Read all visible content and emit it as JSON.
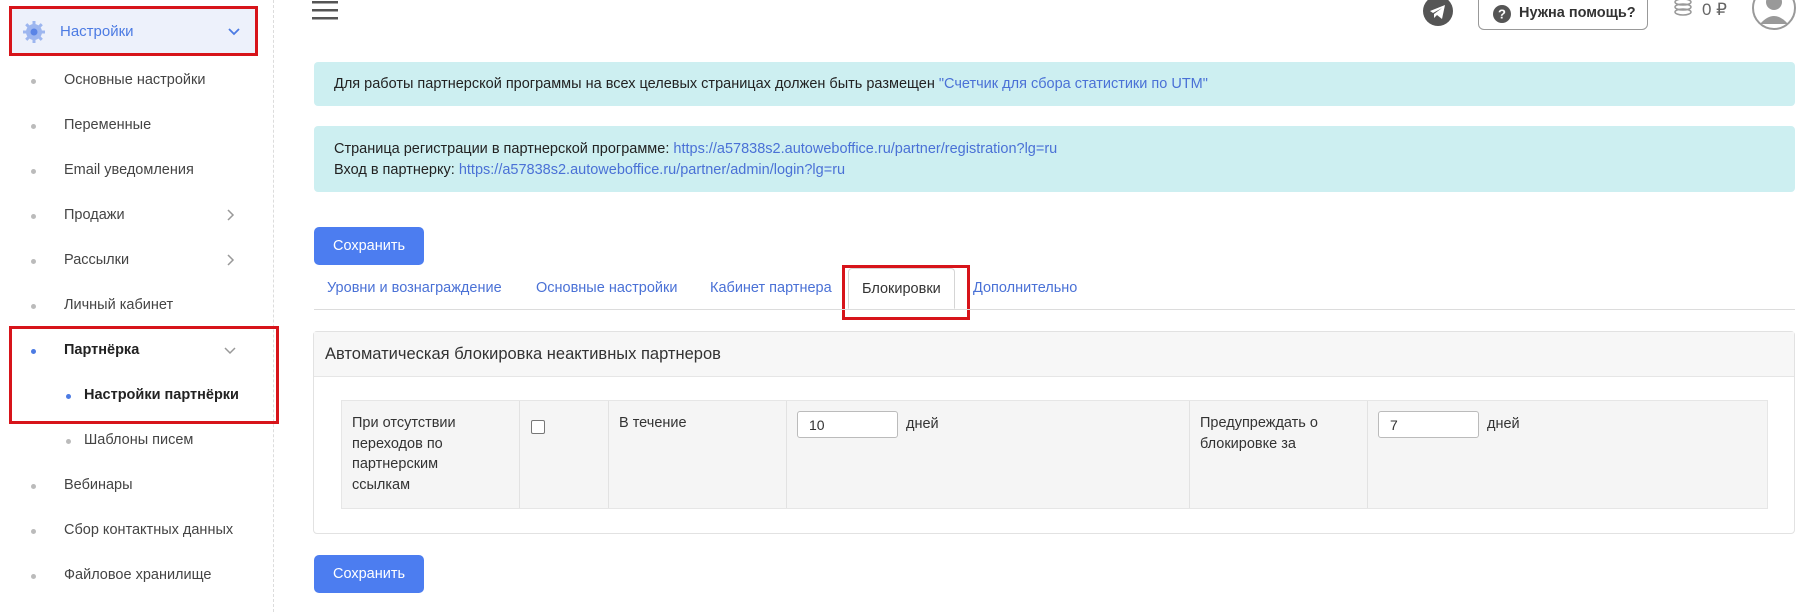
{
  "sidebar": {
    "settings_label": "Настройки",
    "items": [
      {
        "label": "Основные настройки"
      },
      {
        "label": "Переменные"
      },
      {
        "label": "Email уведомления"
      },
      {
        "label": "Продажи"
      },
      {
        "label": "Рассылки"
      },
      {
        "label": "Личный кабинет"
      },
      {
        "label": "Партнёрка"
      },
      {
        "label": "Настройки партнёрки"
      },
      {
        "label": "Шаблоны писем"
      },
      {
        "label": "Вебинары"
      },
      {
        "label": "Сбор контактных данных"
      },
      {
        "label": "Файловое хранилище"
      }
    ]
  },
  "header": {
    "help_label": "Нужна помощь?",
    "balance": "0 ₽"
  },
  "alerts": {
    "utm_text": "Для работы партнерской программы на всех целевых страницах должен быть размещен ",
    "utm_link": "\"Счетчик для сбора статистики по UTM\"",
    "reg_text": "Страница регистрации в партнерской программе: ",
    "reg_link": "https://a57838s2.autoweboffice.ru/partner/registration?lg=ru",
    "login_text": "Вход в партнерку: ",
    "login_link": "https://a57838s2.autoweboffice.ru/partner/admin/login?lg=ru"
  },
  "buttons": {
    "save_label": "Сохранить"
  },
  "tabs": [
    {
      "label": "Уровни и вознаграждение"
    },
    {
      "label": "Основные настройки"
    },
    {
      "label": "Кабинет партнера"
    },
    {
      "label": "Блокировки"
    },
    {
      "label": "Дополнительно"
    }
  ],
  "panel": {
    "title": "Автоматическая блокировка неактивных партнеров",
    "no_clicks_label_lines": [
      "При отсутствии",
      "переходов по",
      "партнерским",
      "ссылкам"
    ],
    "checkbox_checked": false,
    "during_label": "В течение",
    "days_value": "10",
    "days_unit": "дней",
    "warn_label_lines": [
      "Предупреждать о",
      "блокировке за"
    ],
    "warn_days_value": "7",
    "warn_days_unit": "дней"
  },
  "colors": {
    "accent": "#4c7df0",
    "highlight_box": "#d7141a",
    "alert_bg": "#cdeff1"
  }
}
